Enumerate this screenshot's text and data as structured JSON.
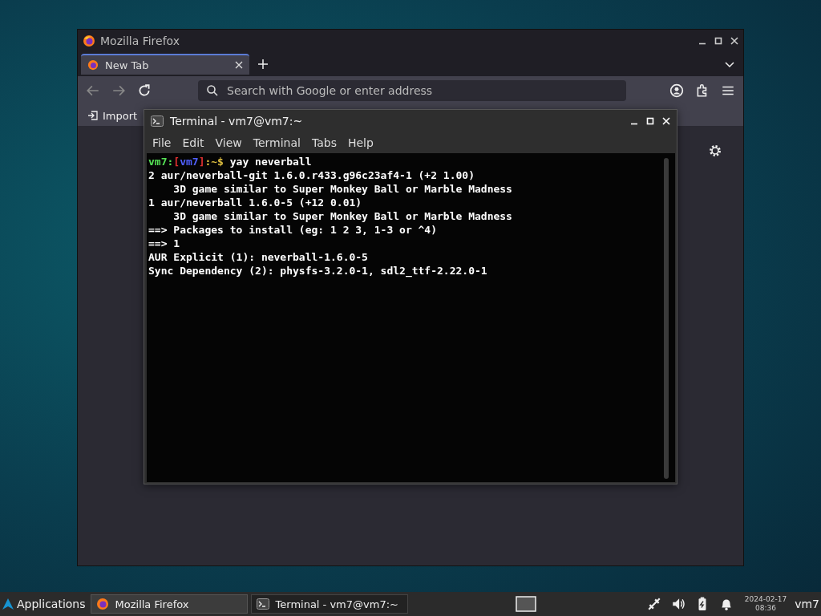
{
  "browser": {
    "title": "Mozilla Firefox",
    "tabs": [
      {
        "label": "New Tab",
        "selected": true
      }
    ],
    "address": {
      "placeholder": "Search with Google or enter address"
    },
    "bookmarks": [
      {
        "label": "Import"
      }
    ]
  },
  "terminal": {
    "title": "Terminal - vm7@vm7:~",
    "menu": [
      "File",
      "Edit",
      "View",
      "Terminal",
      "Tabs",
      "Help"
    ],
    "lines": [
      {
        "kind": "prompt",
        "segments": [
          {
            "text": "vm7:",
            "color": "#55e055"
          },
          {
            "text": "[",
            "color": "#e03030"
          },
          {
            "text": "vm7",
            "color": "#5060ff"
          },
          {
            "text": "]",
            "color": "#e03030"
          },
          {
            "text": ":~$",
            "color": "#e0c040"
          },
          {
            "text": " yay neverball",
            "color": "#ffffff"
          }
        ]
      },
      {
        "kind": "output",
        "text": "2 aur/neverball-git 1.6.0.r433.g96c23af4-1 (+2 1.00)"
      },
      {
        "kind": "output",
        "text": "    3D game similar to Super Monkey Ball or Marble Madness"
      },
      {
        "kind": "output",
        "text": "1 aur/neverball 1.6.0-5 (+12 0.01)"
      },
      {
        "kind": "output",
        "text": "    3D game similar to Super Monkey Ball or Marble Madness"
      },
      {
        "kind": "output",
        "text": "==> Packages to install (eg: 1 2 3, 1-3 or ^4)"
      },
      {
        "kind": "output",
        "text": "==> 1"
      },
      {
        "kind": "output",
        "text": "AUR Explicit (1): neverball-1.6.0-5"
      },
      {
        "kind": "output",
        "text": "Sync Dependency (2): physfs-3.2.0-1, sdl2_ttf-2.22.0-1"
      }
    ]
  },
  "taskbar": {
    "menu": "Applications",
    "tasks": [
      {
        "label": "Mozilla Firefox",
        "kind": "firefox",
        "selected": false
      },
      {
        "label": "Terminal - vm7@vm7:~",
        "kind": "terminal",
        "selected": true
      }
    ],
    "date": "2024-02-17",
    "time": "08:36",
    "user": "vm7"
  }
}
